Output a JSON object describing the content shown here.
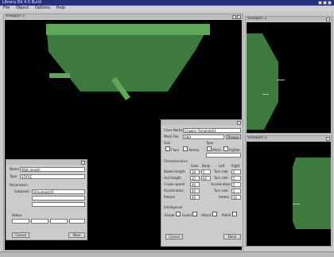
{
  "app": {
    "title": "Library Ed 4.0 Build",
    "menu": [
      "File",
      "Object",
      "Options",
      "Help"
    ]
  },
  "windows": {
    "main_view": {
      "title": "Viewport 1"
    },
    "side_view_top": {
      "title": "Viewport 2"
    },
    "side_view_bottom": {
      "title": "Viewport 3"
    }
  },
  "panel_left": {
    "name_label": "Name",
    "name_value": "Walk length",
    "type_label": "Type",
    "type_value": "STATIC",
    "parameters_label": "Parameters",
    "subpanel_label": "Subpanel",
    "subpanel_value": "Dropdown01",
    "status_label": "Status",
    "cancel_label": "Cancel",
    "next_label": "Next"
  },
  "panel_right": {
    "class_name_label": "Class Name",
    "class_name_value": "Crawler Template01",
    "mesh_file_label": "Mesh File",
    "mesh_file_value": "ENV",
    "browse_label": "Browse",
    "size_label": "Size",
    "type_label": "Type",
    "option_a": "Flare",
    "option_b": "Ammo",
    "option_c": "Mech",
    "option_d": "Fighter",
    "characteristics_label": "Characteristics",
    "col_headers": [
      "Gate",
      "Body",
      "Left",
      "Right"
    ],
    "rows": [
      {
        "label": "Stable length",
        "v1": "30",
        "v2": "5",
        "right_label": "Turn rate",
        "v3": "5"
      },
      {
        "label": "Hull length",
        "v1": "35",
        "v2": "60",
        "right_label": "Turn rate",
        "v3": "5"
      },
      {
        "label": "Cruise speed",
        "v1": "40",
        "v2": "",
        "right_label": "Acceleration",
        "v3": "5"
      },
      {
        "label": "Acceleration",
        "v1": "40",
        "v2": "",
        "right_label": "Turn rate",
        "v3": "5"
      },
      {
        "label": "Reload",
        "v1": "40",
        "v2": "",
        "right_label": "Ammo",
        "v3": "50"
      }
    ],
    "intelligence_label": "Intelligence",
    "intel_options": [
      "Evade",
      "Guard",
      "Attack",
      "Patrol"
    ],
    "cancel_label": "Cancel",
    "done_label": "Done"
  },
  "colors": {
    "shape_fill": "#3d7a3d",
    "shape_light": "#5fa858",
    "titlebar": "#2a2f7a",
    "viewport_bg": "#000000"
  }
}
